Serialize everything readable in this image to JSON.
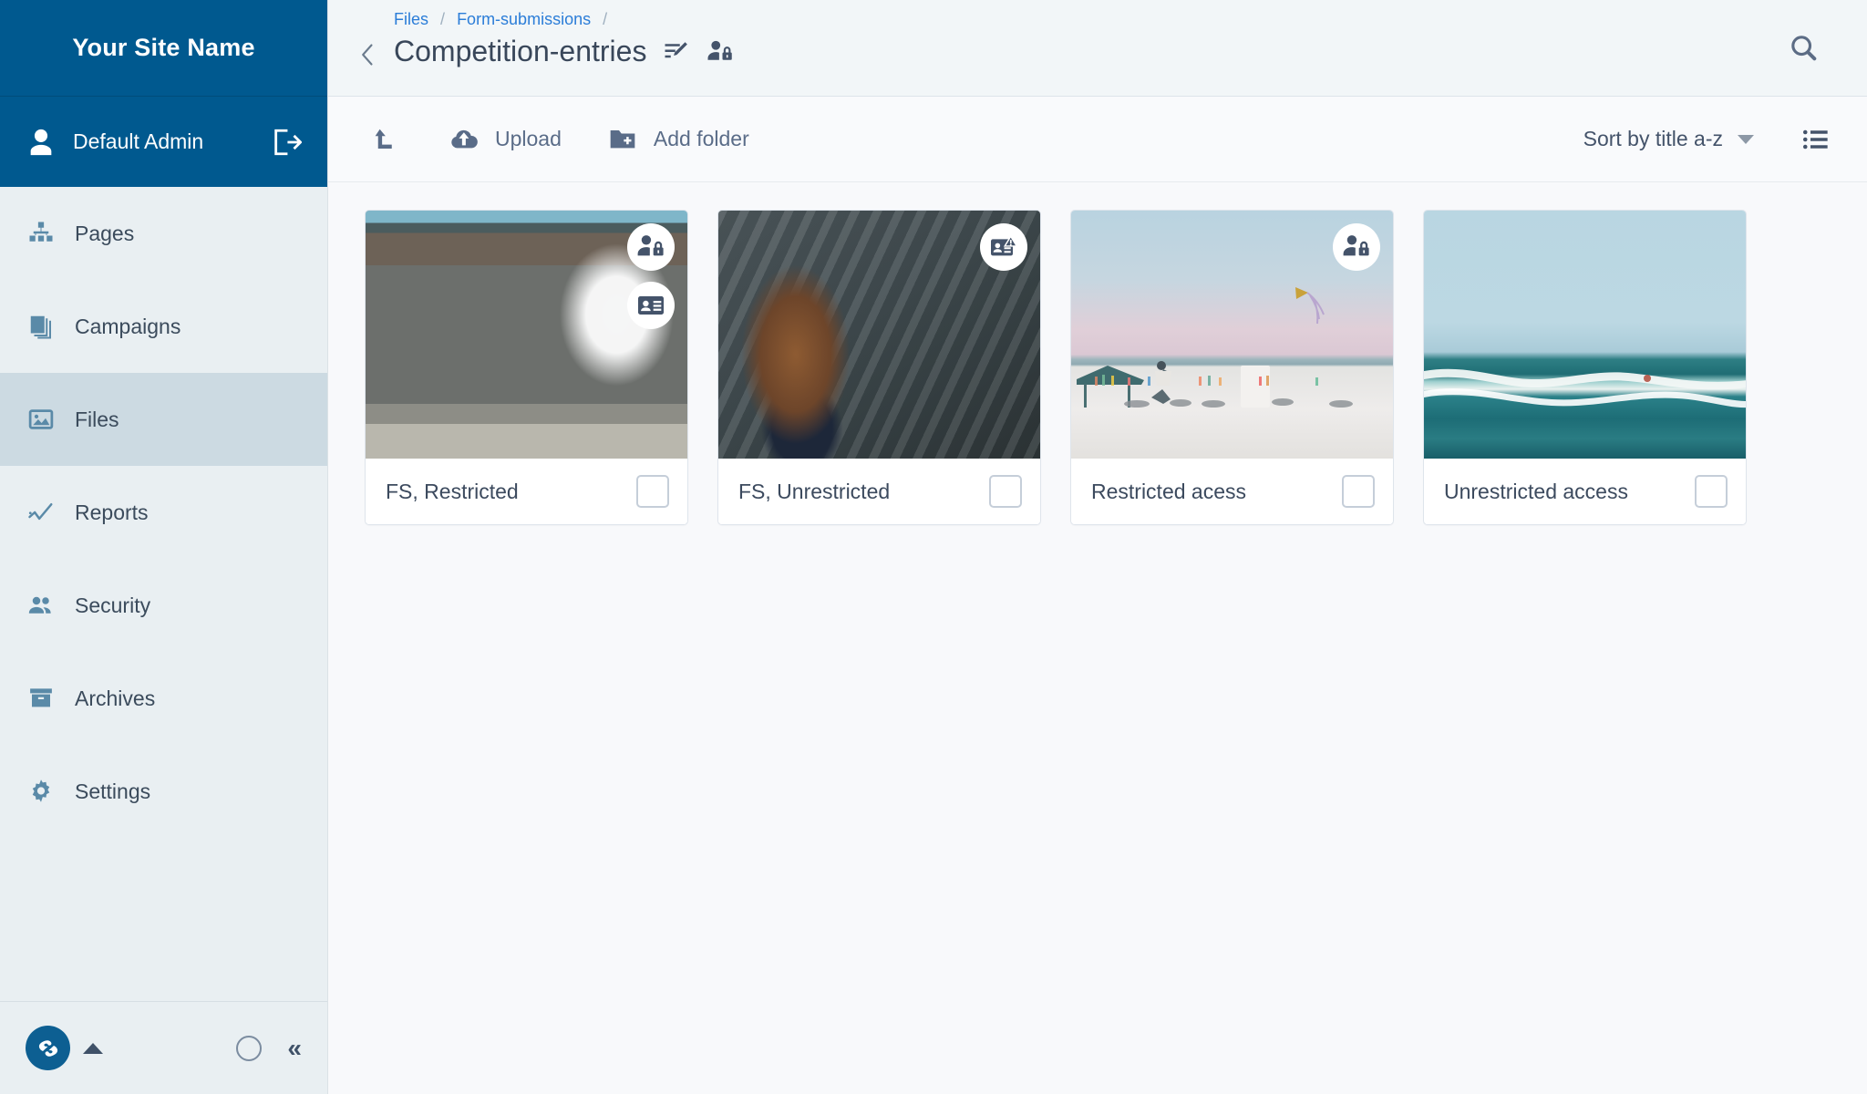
{
  "sidebar": {
    "site_name": "Your Site Name",
    "user": {
      "name": "Default Admin",
      "icon": "user-icon",
      "logout_icon": "logout-icon"
    },
    "items": [
      {
        "label": "Pages",
        "icon": "sitemap-icon",
        "active": false
      },
      {
        "label": "Campaigns",
        "icon": "layers-icon",
        "active": false
      },
      {
        "label": "Files",
        "icon": "image-icon",
        "active": true
      },
      {
        "label": "Reports",
        "icon": "chart-line-icon",
        "active": false
      },
      {
        "label": "Security",
        "icon": "users-icon",
        "active": false
      },
      {
        "label": "Archives",
        "icon": "archive-box-icon",
        "active": false
      },
      {
        "label": "Settings",
        "icon": "gear-icon",
        "active": false
      }
    ],
    "footer": {
      "logo": "silverstripe-logo",
      "expand_icon": "caret-up-icon",
      "status_icon": "circle-icon",
      "collapse_icon": "double-chevron-left-icon",
      "collapse_label": "«"
    }
  },
  "header": {
    "back_icon": "chevron-left-icon",
    "breadcrumb": [
      {
        "label": "Files"
      },
      {
        "label": "Form-submissions"
      }
    ],
    "breadcrumb_separator": "/",
    "title": "Competition-entries",
    "title_icons": [
      {
        "name": "edit-list-icon"
      },
      {
        "name": "person-lock-icon"
      }
    ],
    "search_icon": "search-icon"
  },
  "toolbar": {
    "parent_folder_icon": "level-up-arrow-icon",
    "upload_label": "Upload",
    "upload_icon": "cloud-upload-icon",
    "add_folder_label": "Add folder",
    "add_folder_icon": "folder-plus-icon",
    "sort_label": "Sort by title a-z",
    "sort_caret_icon": "caret-down-icon",
    "view_toggle_icon": "list-view-icon"
  },
  "files": [
    {
      "title": "FS, Restricted",
      "thumb_class": "thumb-buoy",
      "thumb_alt": "life ring buoy on wooden fence",
      "badges": [
        "person-lock-icon",
        "id-card-icon"
      ],
      "selected": false
    },
    {
      "title": "FS, Unrestricted",
      "thumb_class": "thumb-girl",
      "thumb_alt": "girl with braided hair beside water",
      "badges": [
        "id-card-warning-icon"
      ],
      "selected": false
    },
    {
      "title": "Restricted acess",
      "thumb_class": "thumb-beach",
      "thumb_alt": "beach at dusk with kite",
      "badges": [
        "person-lock-icon"
      ],
      "selected": false
    },
    {
      "title": "Unrestricted access",
      "thumb_class": "thumb-ocean",
      "thumb_alt": "ocean waves",
      "badges": [],
      "selected": false
    }
  ],
  "colors": {
    "brand_blue": "#00598f",
    "sidebar_bg": "#e9eff2",
    "sidebar_active": "#ccdae2",
    "icon_blue": "#5a8aa8",
    "text_dark": "#3c4a5e",
    "link_blue": "#2b7dd8",
    "main_bg": "#f8f9fb"
  }
}
